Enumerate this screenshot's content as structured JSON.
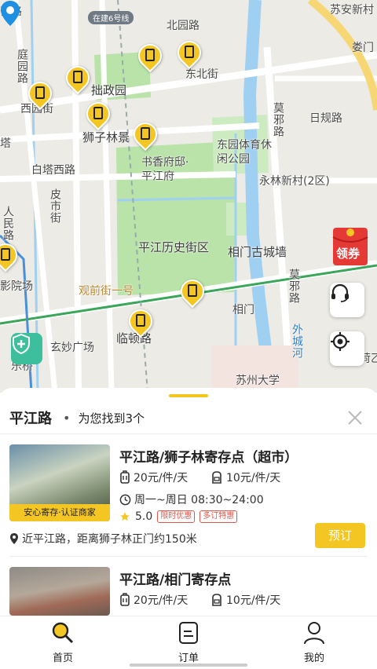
{
  "map": {
    "labels": {
      "line6": "在建6号线",
      "beiyuan": "北园路",
      "suan": "苏安新村",
      "loumen": "娄门",
      "qilu": "齐路",
      "tingyuan": "庭园路",
      "zhuozheng": "拙政园",
      "dongbei": "东北街",
      "xiyuan": "西园街",
      "shizilin": "狮子林景",
      "mobang": "莫邪路",
      "rigui": "日规路",
      "dongyuan": "东园体育休闲公园",
      "baitaxi": "白塔西路",
      "shuxiang": "书香府邸·平江府",
      "yonglin": "永林新村(2区)",
      "pishi": "皮市街",
      "renmin": "人民路",
      "ta": "塔",
      "pingjiang_area": "平江历史街区",
      "xiangmen_wall": "相门古城墙",
      "yuanchang": "影院场",
      "guanqian": "观前街一号",
      "moxie2": "莫邪路",
      "xiangmen": "相门",
      "lindun": "临顿路",
      "xuanmiao": "玄妙广场",
      "waichenghe": "外城河",
      "suda": "苏州大学",
      "leqiao": "乐桥",
      "qiao": "荷乙"
    },
    "coupon_label": "领券"
  },
  "sheet": {
    "title": "平江路",
    "found_text": "为您找到3个"
  },
  "stores": [
    {
      "name": "平江路/狮子林寄存点（超市）",
      "tag": "安心寄存·认证商家",
      "bag_price": "20元/件/天",
      "backpack_price": "10元/件/天",
      "hours": "周一~周日 08:30~24:00",
      "rating": "5.0",
      "chips": [
        "限时优惠",
        "多订特惠"
      ],
      "book_label": "预订",
      "address": "近平江路，距离狮子林正门约150米"
    },
    {
      "name": "平江路/相门寄存点",
      "bag_price": "20元/件/天",
      "backpack_price": "10元/件/天"
    }
  ],
  "tabs": [
    {
      "label": "首页"
    },
    {
      "label": "订单"
    },
    {
      "label": "我的"
    }
  ],
  "colors": {
    "accent": "#f3c623",
    "map_green": "#b9e3a8",
    "water": "#9fd0f2",
    "road_yellow": "#f6d774",
    "metro_green": "#3aa65a",
    "teal": "#3dbf9e"
  }
}
